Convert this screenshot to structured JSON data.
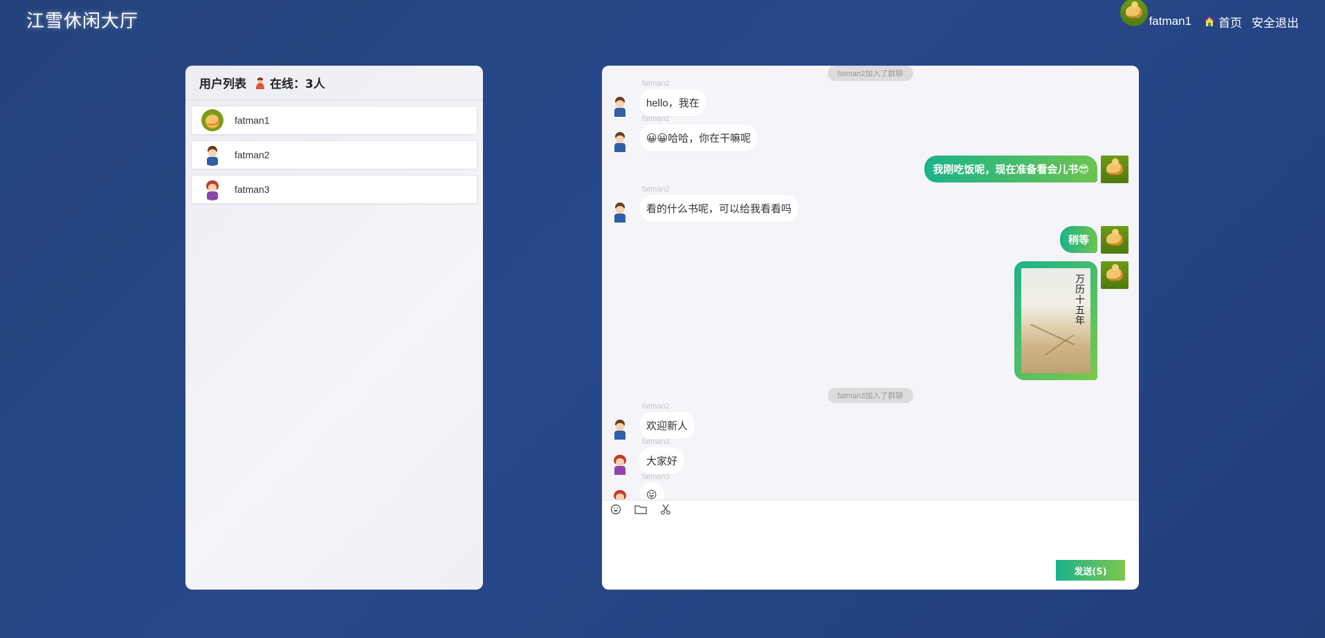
{
  "header": {
    "app_title": "江雪休闲大厅",
    "current_user": "fatman1",
    "home_label": "首页",
    "logout_label": "安全退出"
  },
  "user_panel": {
    "title": "用户列表",
    "online_label": "在线：3人",
    "users": [
      {
        "name": "fatman1",
        "avatar": "fatman1-avatar"
      },
      {
        "name": "fatman2",
        "avatar": "fatman2-avatar"
      },
      {
        "name": "fatman3",
        "avatar": "fatman3-avatar"
      }
    ]
  },
  "chat": {
    "messages": [
      {
        "type": "system",
        "text": "fatman2加入了群聊"
      },
      {
        "type": "left",
        "sender": "fatman2",
        "text": "hello，我在"
      },
      {
        "type": "left",
        "sender": "fatman2",
        "text": "😀😀哈哈，你在干嘛呢"
      },
      {
        "type": "right",
        "sender": "fatman1",
        "text": "我刚吃饭呢，现在准备看会儿书😎"
      },
      {
        "type": "left",
        "sender": "fatman2",
        "text": "看的什么书呢，可以给我看看吗"
      },
      {
        "type": "right",
        "sender": "fatman1",
        "text": "稍等"
      },
      {
        "type": "right-image",
        "sender": "fatman1",
        "image_title": "万历十五年"
      },
      {
        "type": "system",
        "text": "fatman3加入了群聊"
      },
      {
        "type": "left",
        "sender": "fatman2",
        "text": "欢迎新人"
      },
      {
        "type": "left",
        "sender": "fatman3",
        "text": "大家好"
      },
      {
        "type": "left",
        "sender": "fatman3",
        "text": "😛"
      }
    ],
    "tools": [
      "emoji-icon",
      "folder-icon",
      "scissors-icon"
    ],
    "input_value": "",
    "send_label": "发送(S)"
  },
  "colors": {
    "background": "#25447d",
    "accent_start": "#1bb38a",
    "accent_end": "#7cc84a"
  }
}
